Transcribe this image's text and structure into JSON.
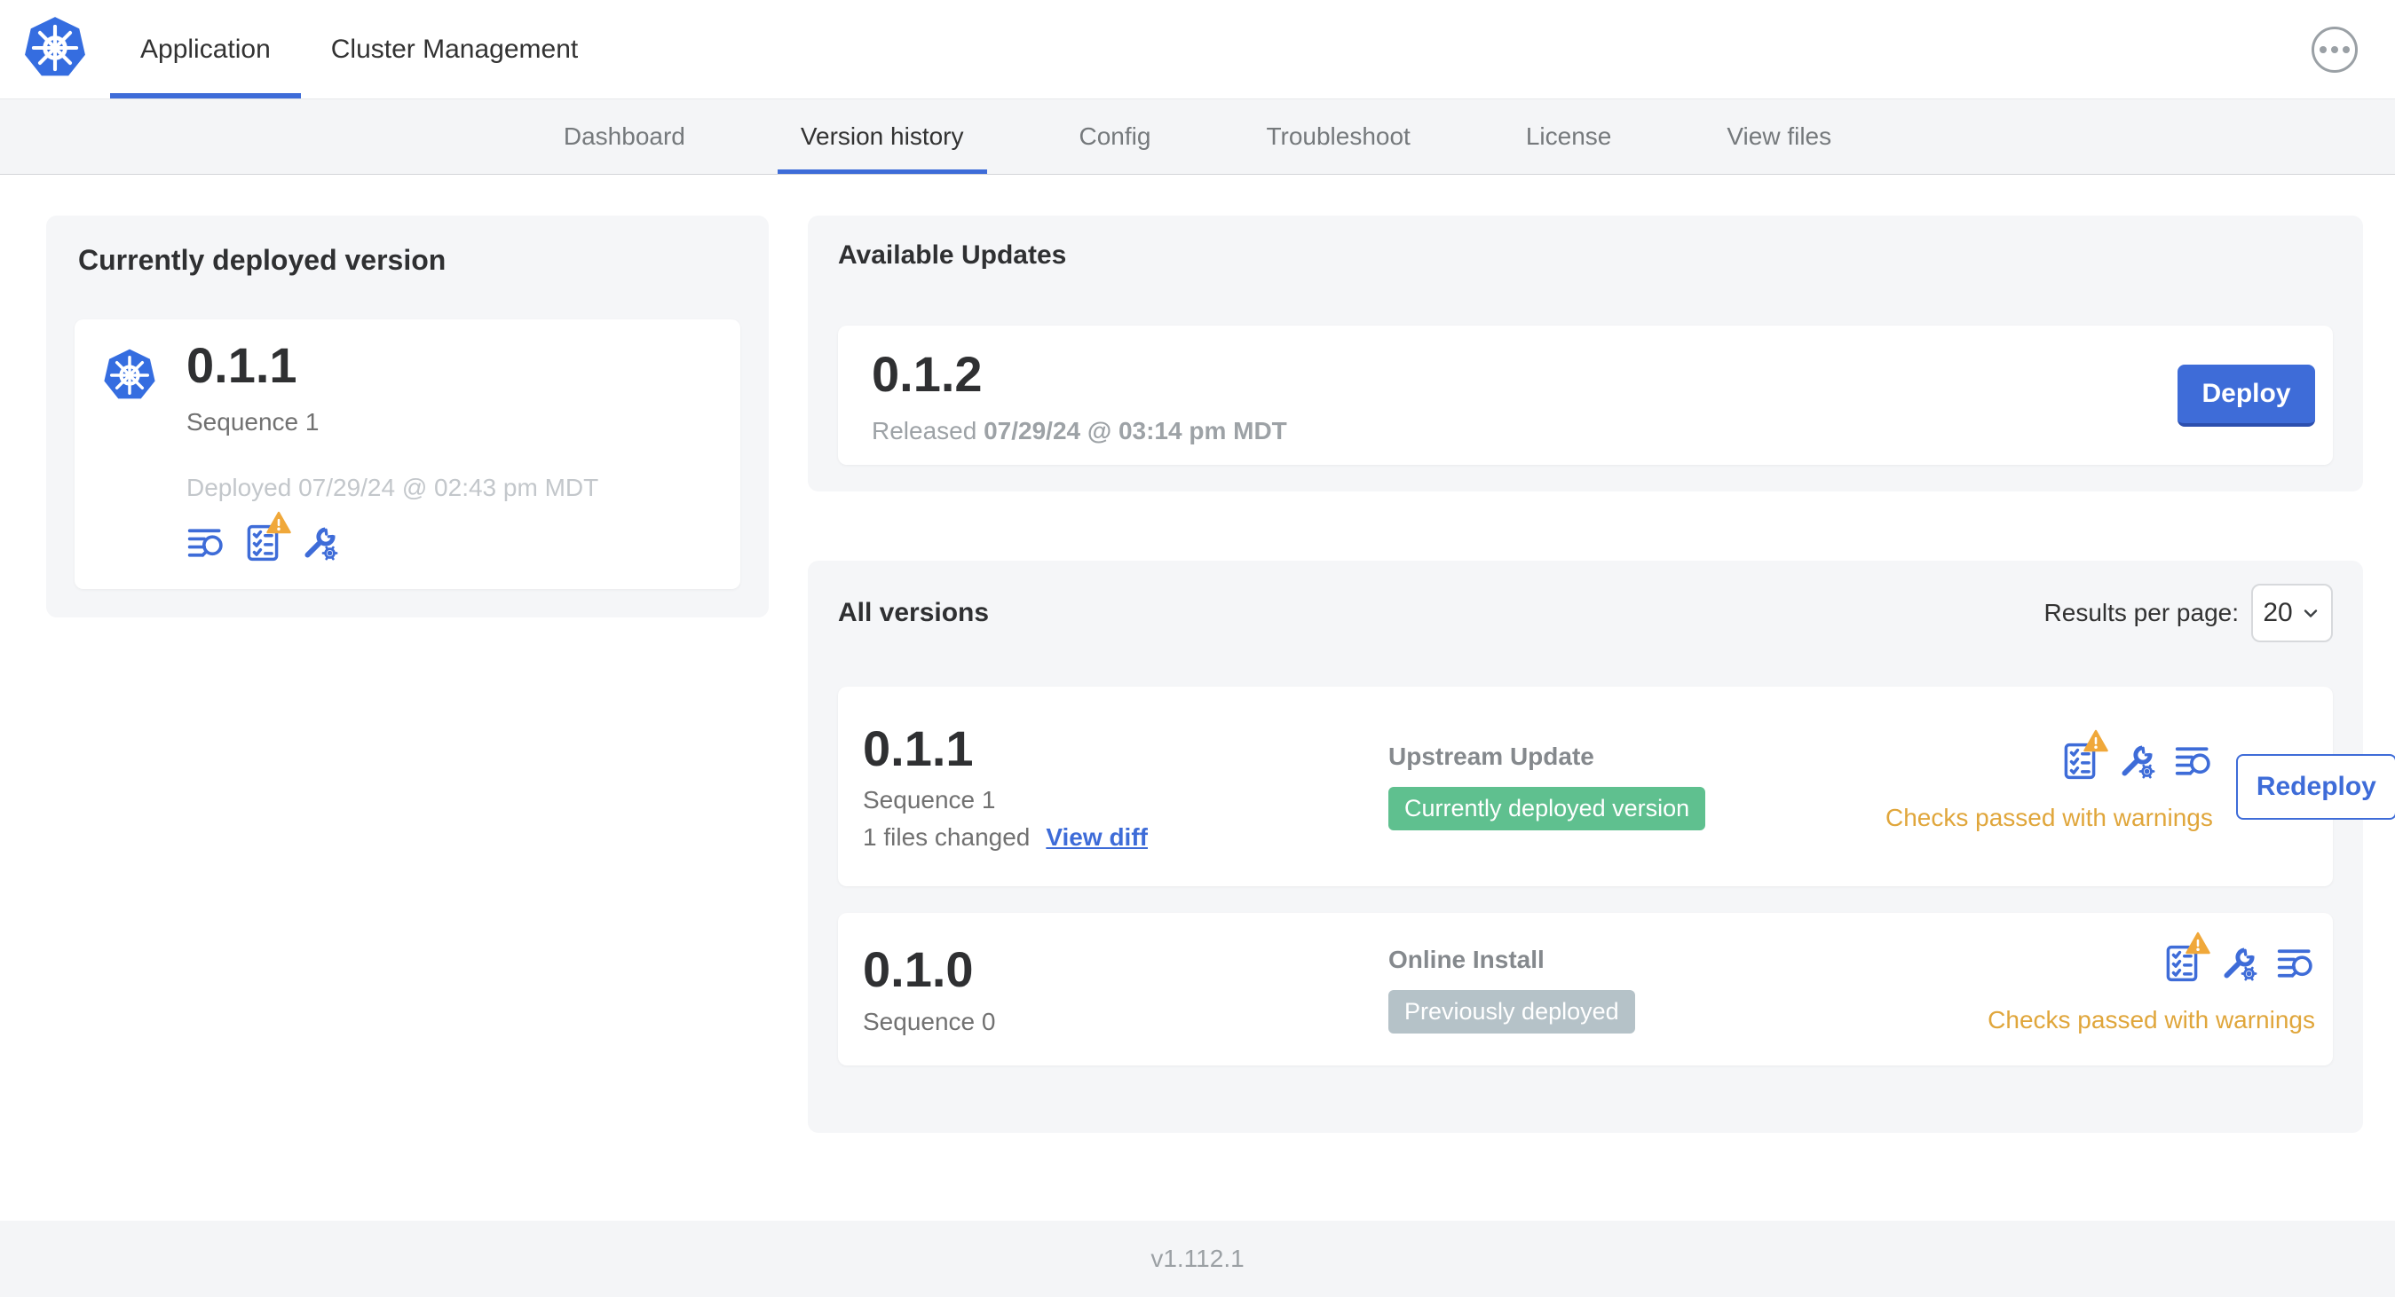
{
  "colors": {
    "primary_blue": "#3e6cd8",
    "kubernetes_blue": "#356de0",
    "green_badge": "#5fc08f",
    "gray_badge": "#b5c2c8",
    "warning_orange": "#e0a63b",
    "warning_triangle": "#f0a83a",
    "dark_text": "#323232",
    "gray_text": "#717171",
    "card_background": "#f5f6f8"
  },
  "header": {
    "logo_icon": "kubernetes-logo",
    "menu_icon": "ellipsis-icon",
    "tabs": [
      {
        "label": "Application",
        "active": true
      },
      {
        "label": "Cluster Management",
        "active": false
      }
    ]
  },
  "subnav": {
    "tabs": [
      {
        "label": "Dashboard",
        "active": false
      },
      {
        "label": "Version history",
        "active": true
      },
      {
        "label": "Config",
        "active": false
      },
      {
        "label": "Troubleshoot",
        "active": false
      },
      {
        "label": "License",
        "active": false
      },
      {
        "label": "View files",
        "active": false
      }
    ]
  },
  "current_version": {
    "title": "Currently deployed version",
    "version": "0.1.1",
    "sequence": "Sequence 1",
    "deployed": "Deployed 07/29/24 @ 02:43 pm MDT",
    "icons": [
      "release-notes-icon",
      "preflight-checks-warning-icon",
      "config-icon"
    ]
  },
  "available_updates": {
    "title": "Available Updates",
    "version": "0.1.2",
    "released_label": "Released",
    "released_date": "07/29/24 @ 03:14 pm MDT",
    "deploy_label": "Deploy"
  },
  "all_versions": {
    "title": "All versions",
    "results_per_page_label": "Results per page:",
    "results_per_page_value": "20",
    "rows": [
      {
        "version": "0.1.1",
        "sequence": "Sequence 1",
        "files_changed": "1 files changed",
        "view_diff_label": "View diff",
        "source": "Upstream Update",
        "badge_label": "Currently deployed version",
        "badge_color": "green",
        "icons": [
          "preflight-checks-warning-icon",
          "config-icon",
          "release-notes-icon"
        ],
        "checks_status": "Checks passed with warnings",
        "action_label": "Redeploy"
      },
      {
        "version": "0.1.0",
        "sequence": "Sequence 0",
        "source": "Online Install",
        "badge_label": "Previously deployed",
        "badge_color": "gray",
        "icons": [
          "preflight-checks-warning-icon",
          "config-icon",
          "release-notes-icon"
        ],
        "checks_status": "Checks passed with warnings"
      }
    ]
  },
  "footer": {
    "app_version": "v1.112.1"
  }
}
